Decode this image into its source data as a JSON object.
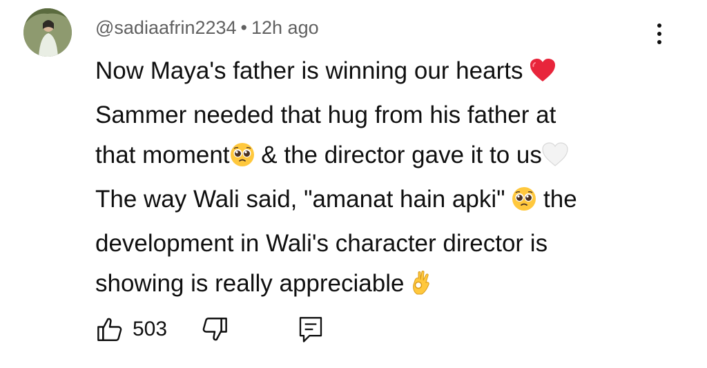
{
  "comment": {
    "author": "@sadiaafrin2234",
    "separator": "•",
    "time": "12h ago",
    "lines": [
      {
        "text": "Now Maya's father is winning our hearts ",
        "emoji": "red-heart"
      },
      {
        "text": "Sammer needed that hug from his father at"
      },
      {
        "text": "that moment",
        "emoji": "pleading-face",
        "text2": " & the director gave it to us",
        "emoji2": "white-heart"
      },
      {
        "text": "The way Wali said, \"amanat hain apki\" ",
        "emoji": "pleading-face",
        "text2": " the"
      },
      {
        "text": "development in Wali's character director is"
      },
      {
        "text": "showing is really appreciable ",
        "emoji": "ok-hand"
      }
    ]
  },
  "actions": {
    "like_count": "503",
    "icons": {
      "like": "thumbs-up-icon",
      "dislike": "thumbs-down-icon",
      "reply": "reply-comment-icon",
      "menu": "more-vertical-icon"
    }
  },
  "colors": {
    "text": "#0f0f0f",
    "meta": "#606060",
    "heart": "#e8253b",
    "emoji_yellow": "#ffc83d"
  }
}
